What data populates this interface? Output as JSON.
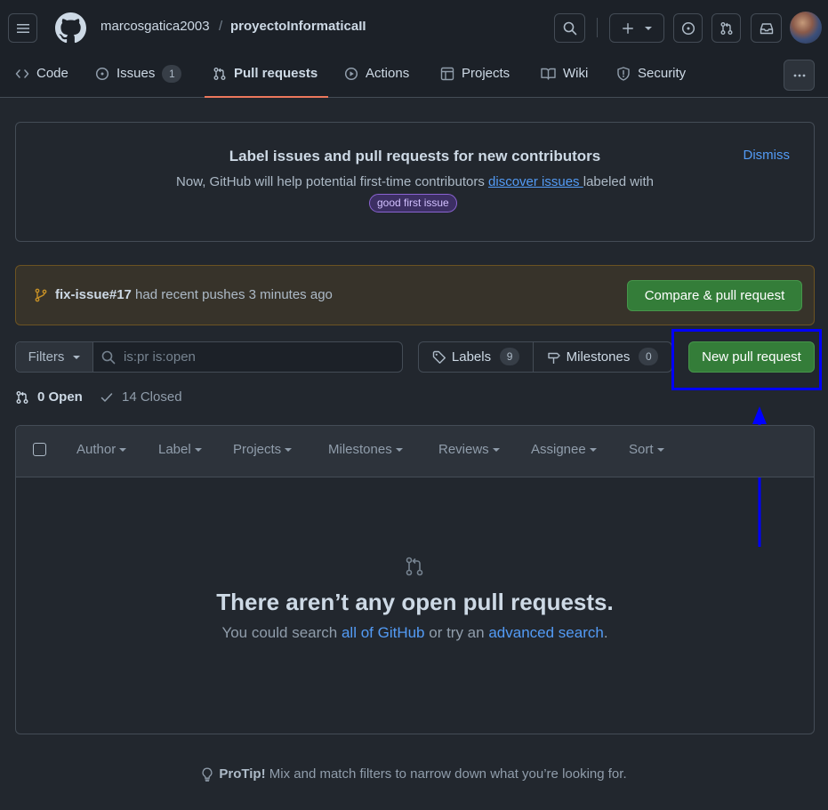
{
  "header": {
    "owner": "marcosgatica2003",
    "separator": "/",
    "repo": "proyectoInformaticaII",
    "avatar_alt": "user avatar"
  },
  "tabs": [
    {
      "label": "Code",
      "icon": "code-icon"
    },
    {
      "label": "Issues",
      "icon": "issue-icon",
      "count": "1"
    },
    {
      "label": "Pull requests",
      "icon": "pull-request-icon"
    },
    {
      "label": "Actions",
      "icon": "play-icon"
    },
    {
      "label": "Projects",
      "icon": "table-icon"
    },
    {
      "label": "Wiki",
      "icon": "book-icon"
    },
    {
      "label": "Security",
      "icon": "shield-icon"
    }
  ],
  "banner": {
    "title": "Label issues and pull requests for new contributors",
    "dismiss": "Dismiss",
    "text_before": "Now, GitHub will help potential first-time contributors ",
    "link": "discover issues ",
    "text_after": "labeled with",
    "badge": "good first issue"
  },
  "push_notice": {
    "branch": "fix-issue#17",
    "message": " had recent pushes 3 minutes ago",
    "button": "Compare & pull request"
  },
  "toolbar": {
    "filters_label": "Filters",
    "search_value": "is:pr is:open",
    "labels_label": "Labels",
    "labels_count": "9",
    "milestones_label": "Milestones",
    "milestones_count": "0",
    "new_pr_label": "New pull request"
  },
  "states": {
    "open": "0 Open",
    "closed": "14 Closed"
  },
  "filters": [
    "Author",
    "Label",
    "Projects",
    "Milestones",
    "Reviews",
    "Assignee",
    "Sort"
  ],
  "empty": {
    "title": "There aren’t any open pull requests.",
    "text1": "You could search ",
    "link1": "all of GitHub",
    "text2": " or try an ",
    "link2": "advanced search",
    "text3": "."
  },
  "protip": {
    "bold": "ProTip!",
    "text": " Mix and match filters to narrow down what you’re looking for."
  },
  "colors": {
    "background": "#22272e",
    "header": "#1c2128",
    "green_button": "#347d39",
    "link": "#539bf5",
    "annotation": "#0000ff",
    "tab_underline": "#ec775c",
    "badge": "#a371f7"
  }
}
